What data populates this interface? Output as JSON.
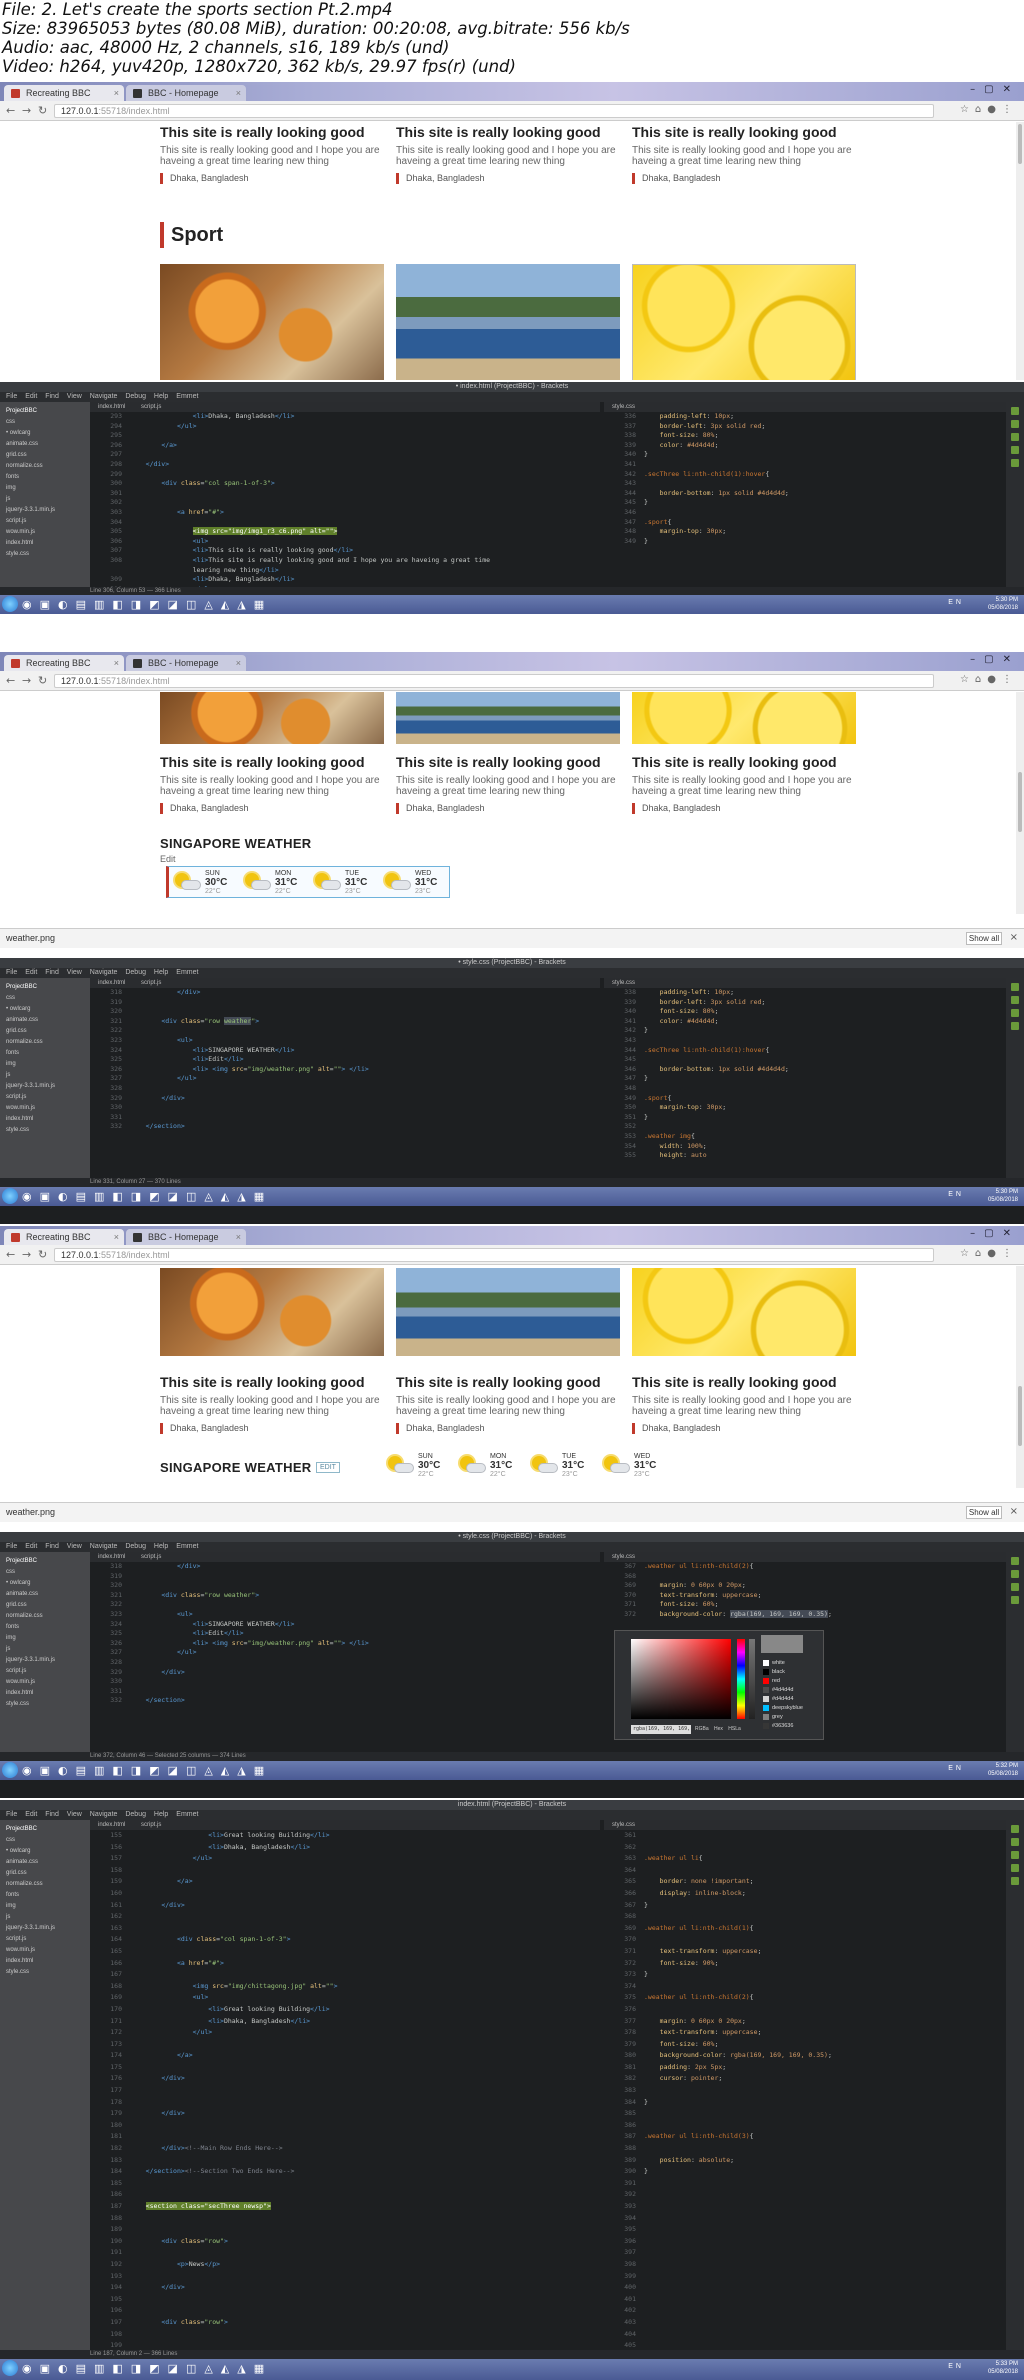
{
  "header": {
    "file": "File: 2. Let's create the sports section Pt.2.mp4",
    "size": "Size: 83965053 bytes (80.08 MiB), duration: 00:20:08, avg.bitrate: 556 kb/s",
    "audio": "Audio: aac, 48000 Hz, 2 channels, s16, 189 kb/s (und)",
    "video": "Video: h264, yuv420p, 1280x720, 362 kb/s, 29.97 fps(r) (und)"
  },
  "browser": {
    "tab1": "Recreating BBC",
    "tab2": "BBC - Homepage",
    "url_host": "127.0.0.1",
    "url_rest": ":55718/index.html"
  },
  "articles": {
    "title": "This site is really looking good",
    "desc": "This site is really looking good and I hope you are haveing a great time learing new thing",
    "location": "Dhaka, Bangladesh"
  },
  "sport": {
    "heading": "Sport"
  },
  "weather": {
    "heading": "SINGAPORE WEATHER",
    "edit": "Edit",
    "edit_badge": "EDIT",
    "days": [
      {
        "day": "SUN",
        "temp": "30°C",
        "low": "22°C"
      },
      {
        "day": "MON",
        "temp": "31°C",
        "low": "22°C"
      },
      {
        "day": "TUE",
        "temp": "31°C",
        "low": "23°C"
      },
      {
        "day": "WED",
        "temp": "31°C",
        "low": "23°C"
      }
    ]
  },
  "download": {
    "file": "weather.png",
    "show_all": "Show all"
  },
  "editor": {
    "title1": "• index.html (ProjectBBC) - Brackets",
    "title2": "• style.css (ProjectBBC) - Brackets",
    "title3": "• style.css (ProjectBBC) - Brackets",
    "title4": "index.html (ProjectBBC) - Brackets",
    "menu": "File Edit Find View Navigate Debug Help Emmet",
    "tabs": "index.html script.js",
    "css_tab": "style.css",
    "project": "ProjectBBC",
    "files": [
      "css",
      "  • owlcarg",
      "  animate.css",
      "  grid.css",
      "  normalize.css",
      "fonts",
      "img",
      "js",
      "  jquery-3.3.1.min.js",
      "  script.js",
      "  wow.min.js",
      "index.html",
      "style.css"
    ],
    "status1": "Line 306, Column 53 — 366 Lines",
    "status2": "Line 331, Column 27 — 370 Lines",
    "status3": "Line 372, Column 46 — Selected 25 columns — 374 Lines",
    "status4": "Line 187, Column 2 — 366 Lines"
  },
  "taskbar": {
    "lang": "EN",
    "time1": "5:30 PM",
    "time2": "5:30 PM",
    "time3": "5:32 PM",
    "time4": "5:33 PM",
    "date": "05/08/2018"
  },
  "picker": {
    "value": "rgba(169, 169, 169, 0.35)",
    "modes": "RGBa Hex HSLa",
    "swatches": [
      "white",
      "black",
      "red",
      "#4d4d4d",
      "#d4d4d4",
      "deepskyblue",
      "grey",
      "#363636"
    ]
  }
}
